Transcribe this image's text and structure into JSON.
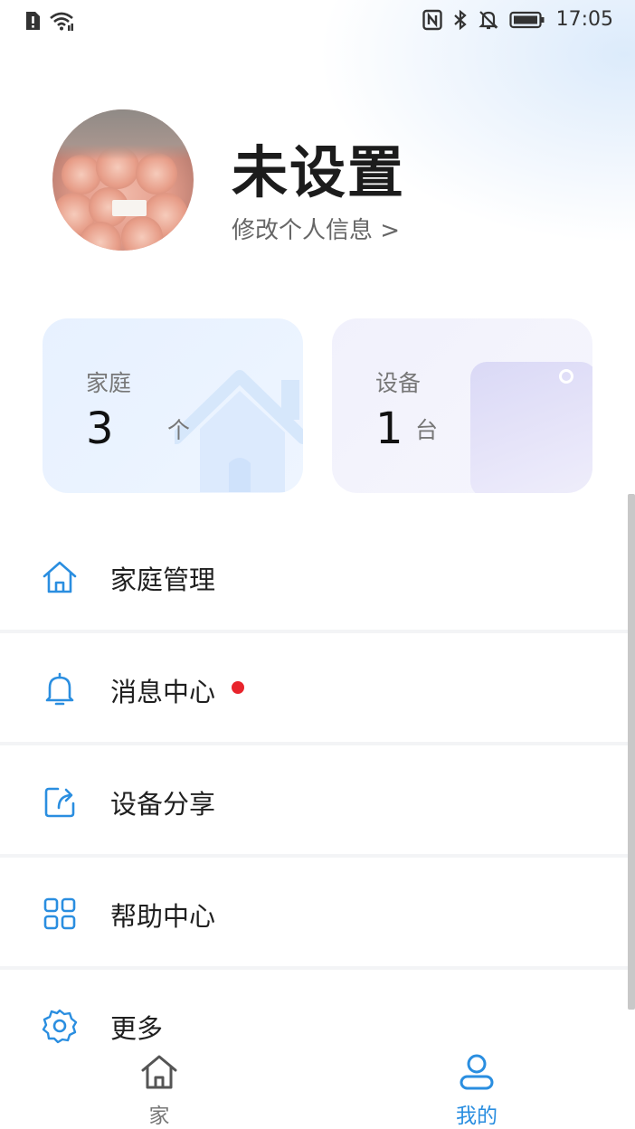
{
  "status_bar": {
    "time": "17:05",
    "icons": [
      "alert-sim-icon",
      "wifi-icon",
      "nfc-icon",
      "bluetooth-icon",
      "mute-bell-icon",
      "battery-icon"
    ]
  },
  "profile": {
    "name": "未设置",
    "edit_link": "修改个人信息 >"
  },
  "stats": {
    "home": {
      "label": "家庭",
      "count": "3",
      "unit": "个"
    },
    "device": {
      "label": "设备",
      "count": "1",
      "unit": "台"
    }
  },
  "menu": [
    {
      "label": "家庭管理",
      "icon": "home-icon"
    },
    {
      "label": "消息中心",
      "icon": "bell-icon",
      "unread": true
    },
    {
      "label": "设备分享",
      "icon": "share-icon"
    },
    {
      "label": "帮助中心",
      "icon": "grid-icon"
    },
    {
      "label": "更多",
      "icon": "gear-icon"
    }
  ],
  "bottom_nav": {
    "home": {
      "label": "家",
      "icon": "house-icon"
    },
    "mine": {
      "label": "我的",
      "icon": "user-icon",
      "active": true
    }
  },
  "colors": {
    "accent": "#2a8ee0",
    "badge": "#e8242c",
    "home_card": "#e7f1ff",
    "device_card": "#f1f1fc"
  }
}
